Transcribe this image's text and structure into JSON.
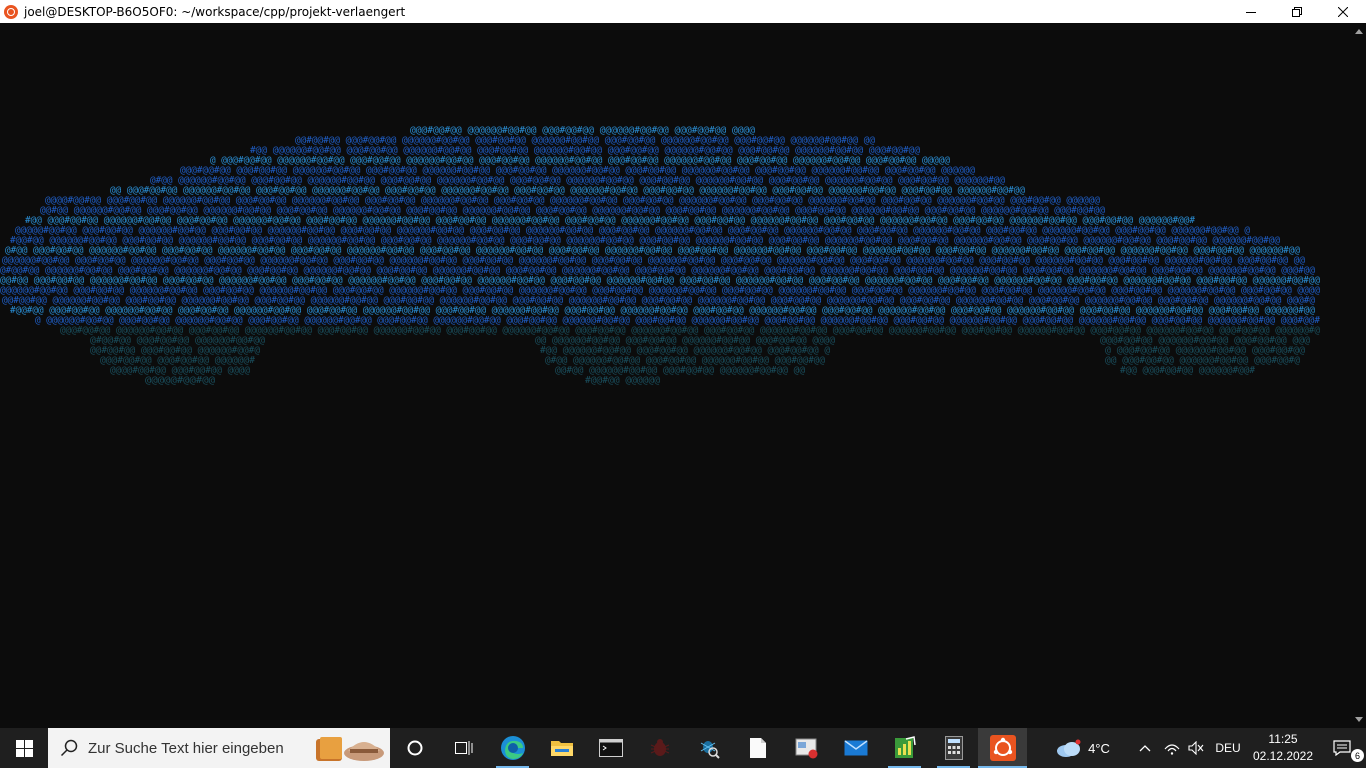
{
  "window": {
    "title": "joel@DESKTOP-B6O5OF0: ~/workspace/cpp/projekt-verlaengert",
    "minimize_icon": "minimize-icon",
    "maximize_icon": "restore-icon",
    "close_icon": "close-icon"
  },
  "terminal": {
    "background": "#0c0c0c",
    "art_colors": {
      "primary": "#1f5fc8",
      "secondary": "#2a8fd6",
      "dim": "#1a4f5e"
    },
    "art_description_glyphs": [
      "@",
      "#"
    ]
  },
  "taskbar": {
    "search_placeholder": "Zur Suche Text hier eingeben",
    "apps": [
      {
        "name": "task-view-cortana",
        "icon": "circle-icon"
      },
      {
        "name": "task-view",
        "icon": "task-view-icon"
      },
      {
        "name": "edge",
        "icon": "edge-icon"
      },
      {
        "name": "file-explorer",
        "icon": "folder-icon"
      },
      {
        "name": "terminal",
        "icon": "terminal-icon"
      },
      {
        "name": "bug-app",
        "icon": "bug-icon"
      },
      {
        "name": "debugger-app",
        "icon": "magnifier-bug-icon"
      },
      {
        "name": "notepad",
        "icon": "document-icon"
      },
      {
        "name": "remote-app",
        "icon": "window-record-icon"
      },
      {
        "name": "mail",
        "icon": "mail-icon"
      },
      {
        "name": "chart-app",
        "icon": "chart-icon"
      },
      {
        "name": "calculator",
        "icon": "calculator-icon"
      },
      {
        "name": "ubuntu",
        "icon": "ubuntu-icon"
      }
    ],
    "weather": {
      "temp": "4°C",
      "icon": "cloud-icon"
    },
    "tray": {
      "language": "DEU",
      "time": "11:25",
      "date": "02.12.2022",
      "notifications": "6"
    }
  }
}
